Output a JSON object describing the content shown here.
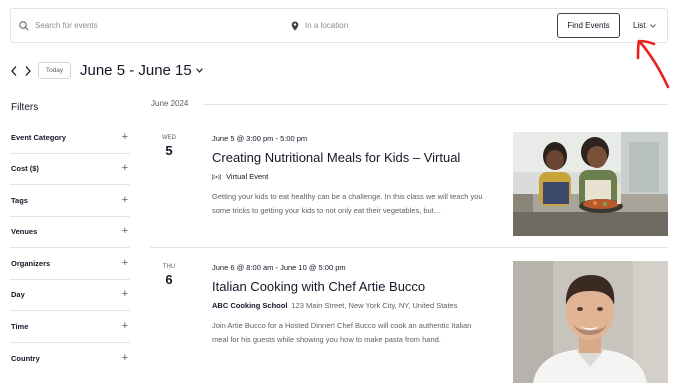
{
  "search": {
    "keyword_placeholder": "Search for events",
    "location_placeholder": "In a location",
    "find_button": "Find Events",
    "view_label": "List"
  },
  "nav": {
    "today_label": "Today",
    "date_range": "June 5 - June 15"
  },
  "filters": {
    "title": "Filters",
    "items": [
      {
        "label": "Event Category"
      },
      {
        "label": "Cost ($)"
      },
      {
        "label": "Tags"
      },
      {
        "label": "Venues"
      },
      {
        "label": "Organizers"
      },
      {
        "label": "Day"
      },
      {
        "label": "Time"
      },
      {
        "label": "Country"
      }
    ]
  },
  "month_separator": "June 2024",
  "events": [
    {
      "dow": "WED",
      "day": "5",
      "datetime": "June 5 @ 3:00 pm - 5:00 pm",
      "title": "Creating Nutritional Meals for Kids – Virtual",
      "venue_label": "Virtual Event",
      "description": "Getting your kids to eat healthy can be a challenge. In this class we will teach you some tricks to getting your kids to not only eat their vegetables, but…"
    },
    {
      "dow": "THU",
      "day": "6",
      "datetime": "June 6 @ 8:00 am - June 10 @ 5:00 pm",
      "title": "Italian Cooking with Chef Artie Bucco",
      "venue_name": "ABC Cooking School",
      "venue_address": "123 Main Street, New York City, NY, United States",
      "description": "Join Artie Bucco for a Hosted Dinner! Chef Bucco will cook an authentic Italian meal for his guests while showing you how to make pasta from hand."
    }
  ],
  "colors": {
    "text": "#141827",
    "muted": "#5d5f65",
    "border": "#e4e4e4",
    "annotation": "#e8231f"
  },
  "icons": {
    "search": "search-icon",
    "location": "location-pin-icon",
    "virtual": "virtual-event-icon",
    "chevron": "chevron-down-icon"
  }
}
